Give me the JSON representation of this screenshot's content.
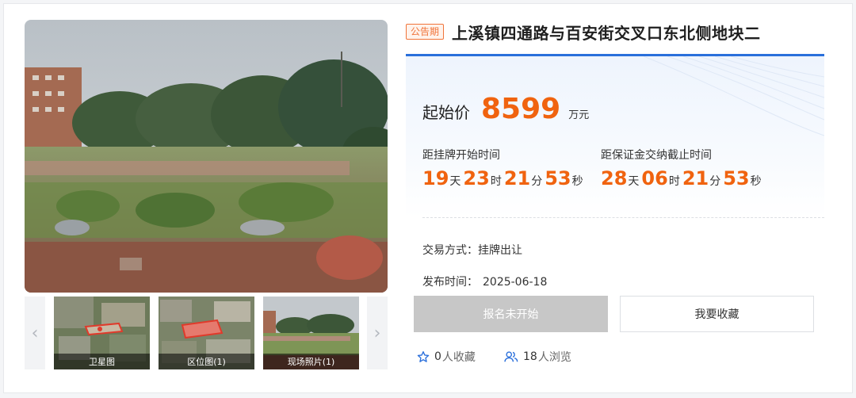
{
  "gallery": {
    "thumbs": [
      {
        "caption": "卫星图"
      },
      {
        "caption": "区位图(1)"
      },
      {
        "caption": "现场照片(1)"
      }
    ],
    "prev_icon": "chevron-left-icon",
    "next_icon": "chevron-right-icon"
  },
  "listing": {
    "status_badge": "公告期",
    "title": "上溪镇四通路与百安街交叉口东北侧地块二",
    "price_label": "起始价",
    "price_value": "8599",
    "price_unit": "万元",
    "countdowns": [
      {
        "label": "距挂牌开始时间",
        "days": "19",
        "hours": "23",
        "minutes": "21",
        "seconds": "53"
      },
      {
        "label": "距保证金交纳截止时间",
        "days": "28",
        "hours": "06",
        "minutes": "21",
        "seconds": "53"
      }
    ],
    "units": {
      "day": "天",
      "hour": "时",
      "minute": "分",
      "second": "秒"
    },
    "trade_label": "交易方式：",
    "trade_value": "挂牌出让",
    "publish_label": "发布时间：",
    "publish_value": "2025-06-18"
  },
  "actions": {
    "register_label": "报名未开始",
    "favorite_label": "我要收藏"
  },
  "stats": {
    "fav_count": "0",
    "fav_suffix": "人收藏",
    "view_count": "18",
    "view_suffix": "人浏览"
  },
  "colors": {
    "accent": "#f0630f",
    "brand_blue": "#2a6fdb",
    "badge_border": "#f0743a"
  }
}
